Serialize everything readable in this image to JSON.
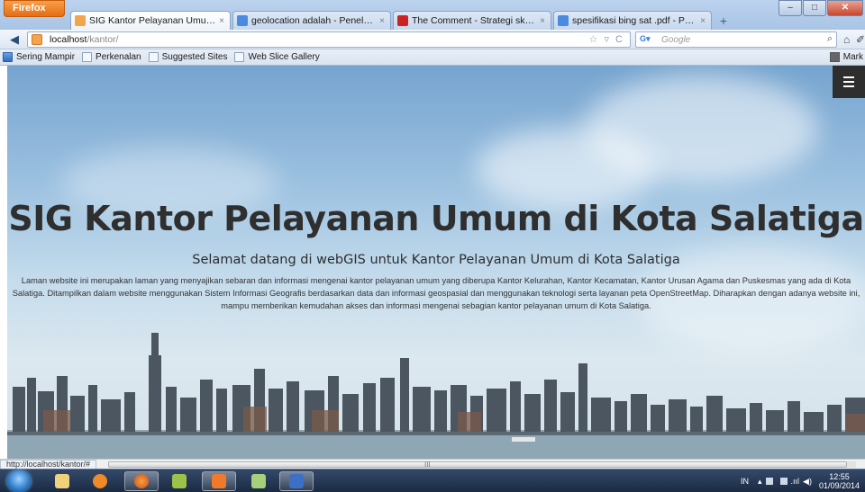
{
  "browser": {
    "app_button": "Firefox",
    "tabs": [
      {
        "label": "SIG Kantor Pelayanan Umum di Salati...",
        "close": "×",
        "color": "#f2a54a",
        "active": true
      },
      {
        "label": "geolocation adalah - Penelusuran Go...",
        "close": "×",
        "color": "#4a8ae0",
        "active": false
      },
      {
        "label": "The Comment - Strategi skripsi ala D...",
        "close": "×",
        "color": "#cc2222",
        "active": false
      },
      {
        "label": "spesifikasi bing sat .pdf - Penelusuran...",
        "close": "×",
        "color": "#4a8ae0",
        "active": false
      }
    ],
    "new_tab": "+",
    "url_host": "localhost",
    "url_path": "/kantor/",
    "search_placeholder": "Google",
    "bookmarks": [
      "Sering Mampir",
      "Perkenalan",
      "Suggested Sites",
      "Web Slice Gallery"
    ],
    "bookmarks_right": "Mark"
  },
  "hero": {
    "title": "SIG Kantor Pelayanan Umum di Kota Salatiga",
    "subtitle": "Selamat datang di webGIS untuk Kantor Pelayanan Umum di Kota Salatiga",
    "description": "Laman website ini merupakan laman yang menyajikan sebaran dan informasi mengenai kantor pelayanan umum yang diberupa Kantor Kelurahan, Kantor Kecamatan, Kantor Urusan Agama dan Puskesmas yang ada di Kota Salatiga. Ditampilkan dalam website menggunakan Sistem Informasi Geografis berdasarkan data dan informasi geospasial dan menggunakan teknologi serta layanan peta OpenStreetMap. Diharapkan dengan adanya website ini, mampu memberikan kemudahan akses dan informasi mengenai sebagian kantor pelayanan umum di Kota Salatiga."
  },
  "status": {
    "url": "http://localhost/kantor/#",
    "scroll_grip": "III"
  },
  "taskbar": {
    "lang": "IN",
    "time": "12:55",
    "date": "01/09/2014"
  }
}
